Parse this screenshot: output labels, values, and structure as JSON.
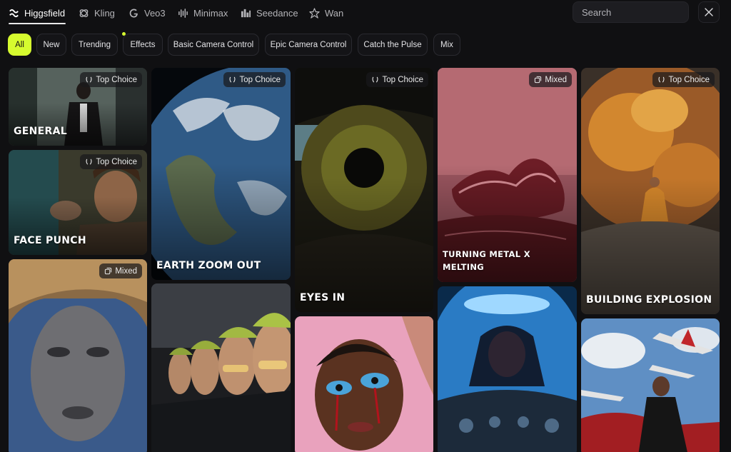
{
  "nav": {
    "tabs": [
      {
        "label": "Higgsfield",
        "icon": "higgsfield-logo-icon"
      },
      {
        "label": "Kling",
        "icon": "kling-logo-icon"
      },
      {
        "label": "Veo3",
        "icon": "google-logo-icon"
      },
      {
        "label": "Minimax",
        "icon": "minimax-wave-icon"
      },
      {
        "label": "Seedance",
        "icon": "seedance-bars-icon"
      },
      {
        "label": "Wan",
        "icon": "wan-logo-icon"
      }
    ],
    "search_placeholder": "Search"
  },
  "filters": [
    "All",
    "New",
    "Trending",
    "Effects",
    "Basic Camera Control",
    "Epic Camera Control",
    "Catch the Pulse",
    "Mix"
  ],
  "badges": {
    "top_choice": "Top Choice",
    "mixed": "Mixed"
  },
  "cards": [
    {
      "title": "GENERAL",
      "badge": "Top Choice"
    },
    {
      "title": "FACE PUNCH",
      "badge": "Top Choice"
    },
    {
      "title": "",
      "badge": "Mixed"
    },
    {
      "title": "EARTH ZOOM OUT",
      "badge": "Top Choice"
    },
    {
      "title": "",
      "badge": ""
    },
    {
      "title": "EYES IN",
      "badge": "Top Choice"
    },
    {
      "title": "",
      "badge": ""
    },
    {
      "title_line1": "TURNING METAL X",
      "title_line2": "MELTING",
      "badge": "Mixed"
    },
    {
      "title": "",
      "badge": ""
    },
    {
      "title": "BUILDING EXPLOSION",
      "badge": "Top Choice"
    },
    {
      "title": "",
      "badge": ""
    }
  ],
  "colors": {
    "accent": "#d6fb2f",
    "background": "#101012"
  }
}
